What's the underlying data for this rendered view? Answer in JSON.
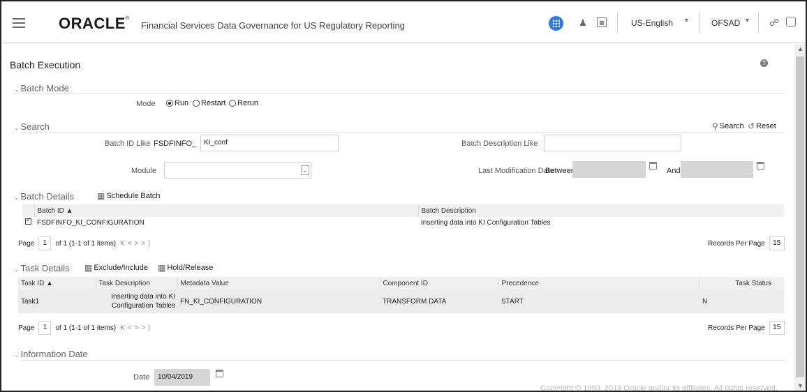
{
  "header": {
    "logo": "ORACLE",
    "logo_mark": "®",
    "app_title": "Financial Services Data Governance for US Regulatory Reporting",
    "language": "US-English",
    "user": "OFSAD",
    "accent": "#2d7bd8"
  },
  "page": {
    "title": "Batch Execution"
  },
  "batch_mode": {
    "section": "Batch Mode",
    "mode_label": "Mode",
    "options": [
      "Run",
      "Restart",
      "Rerun"
    ],
    "selected": "Run"
  },
  "search": {
    "section": "Search",
    "search_label": "Search",
    "reset_label": "Reset",
    "batch_id_label": "Batch ID Like",
    "batch_id_prefix": "FSDFINFO_",
    "batch_id_value": "KI_conf",
    "batch_desc_label": "Batch Description Like",
    "batch_desc_value": "",
    "module_label": "Module",
    "module_value": "",
    "last_mod_label": "Last Modification Date",
    "between_label": "Between",
    "and_label": "And"
  },
  "batch_details": {
    "section": "Batch Details",
    "schedule_label": "Schedule Batch",
    "columns": [
      "Batch ID",
      "Batch Description"
    ],
    "rows": [
      {
        "batch_id": "FSDFINFO_KI_CONFIGURATION",
        "description": "Inserting data into KI Configuration Tables"
      }
    ],
    "page_label": "Page",
    "page_num": "1",
    "page_info": "of 1 (1-1 of 1 items)",
    "rpp_label": "Records Per Page",
    "rpp_value": "15"
  },
  "task_details": {
    "section": "Task Details",
    "exclude_label": "Exclude/Include",
    "hold_label": "Hold/Release",
    "columns": [
      "Task ID",
      "Task Description",
      "Metadata Value",
      "Component ID",
      "Precedence",
      "Task Status"
    ],
    "rows": [
      {
        "task_id": "Task1",
        "description_1": "Inserting data into KI",
        "description_2": "Configuration Tables",
        "metadata": "FN_KI_CONFIGURATION",
        "component": "TRANSFORM DATA",
        "precedence": "START",
        "status": "N"
      }
    ],
    "page_label": "Page",
    "page_num": "1",
    "page_info": "of 1 (1-1 of 1 items)",
    "rpp_label": "Records Per Page",
    "rpp_value": "15"
  },
  "information_date": {
    "section": "Information Date",
    "date_label": "Date",
    "date_value": "10/04/2019"
  },
  "footer": {
    "copyright": "Copyright © 1993, 2019 Oracle and/or its affiliates. All rights reserved."
  }
}
